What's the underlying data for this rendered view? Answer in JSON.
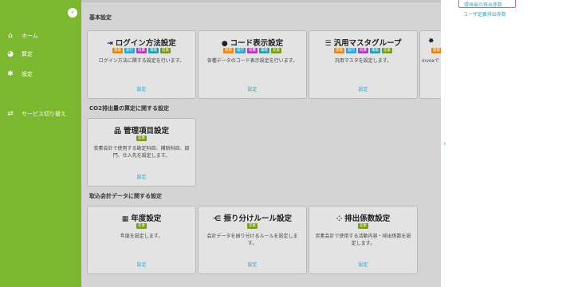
{
  "sidebar": {
    "collapse_icon": "chevron-left-icon",
    "items": [
      {
        "label": "ホーム",
        "icon": "home-icon"
      },
      {
        "label": "算定",
        "icon": "calculator-icon"
      },
      {
        "label": "設定",
        "icon": "gear-icon"
      },
      {
        "label": "サービス切り替え",
        "icon": "switch-icon"
      }
    ]
  },
  "sections": {
    "basic": "基本設定",
    "co2": "CO2排出量の算定に関する設定",
    "import": "取込会計データに関する設定"
  },
  "badge_colors": {
    "受取": "#e08a1e",
    "発行": "#3aa0c8",
    "経費": "#b03ab8",
    "電帳": "#2a9ba8",
    "炭素": "#7a9a1e"
  },
  "cards": {
    "login": {
      "title": "ログイン方法設定",
      "icon": "login-icon",
      "badges": [
        "受取",
        "発行",
        "経費",
        "電帳",
        "炭素"
      ],
      "desc": "ログイン方法に関する設定を行います。",
      "link": "設定"
    },
    "code": {
      "title": "コード表示設定",
      "icon": "code-icon",
      "badges": [
        "受取",
        "発行",
        "経費",
        "電帳",
        "炭素"
      ],
      "desc": "各種データのコード表示設定を行います。",
      "link": "設定"
    },
    "master": {
      "title": "汎用マスタグループ",
      "icon": "list-icon",
      "badges": [
        "受取",
        "発行",
        "経費",
        "電帳",
        "炭素"
      ],
      "desc": "汎用マスタを設定します。",
      "link": "設定"
    },
    "partial": {
      "title": "",
      "icon": "settings-icon",
      "badges": [
        "受取"
      ],
      "desc": "invoxで",
      "link": ""
    },
    "mgmt": {
      "title": "管理項目設定",
      "icon": "sitemap-icon",
      "badges": [
        "炭素"
      ],
      "desc": "炭素会計で使用する勘定科目、補助科目、部門、仕入先を設定します。",
      "link": "設定"
    },
    "year": {
      "title": "年度設定",
      "icon": "calendar-icon",
      "badges": [
        "炭素"
      ],
      "desc": "年度を設定します。",
      "link": "設定"
    },
    "rule": {
      "title": "振り分けルール設定",
      "icon": "branch-icon",
      "badges": [
        "炭素"
      ],
      "desc": "会計データを振り分けるルールを設定します。",
      "link": "設定"
    },
    "factor": {
      "title": "排出係数設定",
      "icon": "grid-icon",
      "badges": [
        "炭素"
      ],
      "desc": "炭素会計で使用する活動内容・排出係数を設定します。",
      "link": "設定"
    }
  },
  "right_panel": {
    "item1": "環境省の排出係数",
    "item2": "ユーザ定義排出係数",
    "expand_icon": "chevron-right-icon"
  }
}
